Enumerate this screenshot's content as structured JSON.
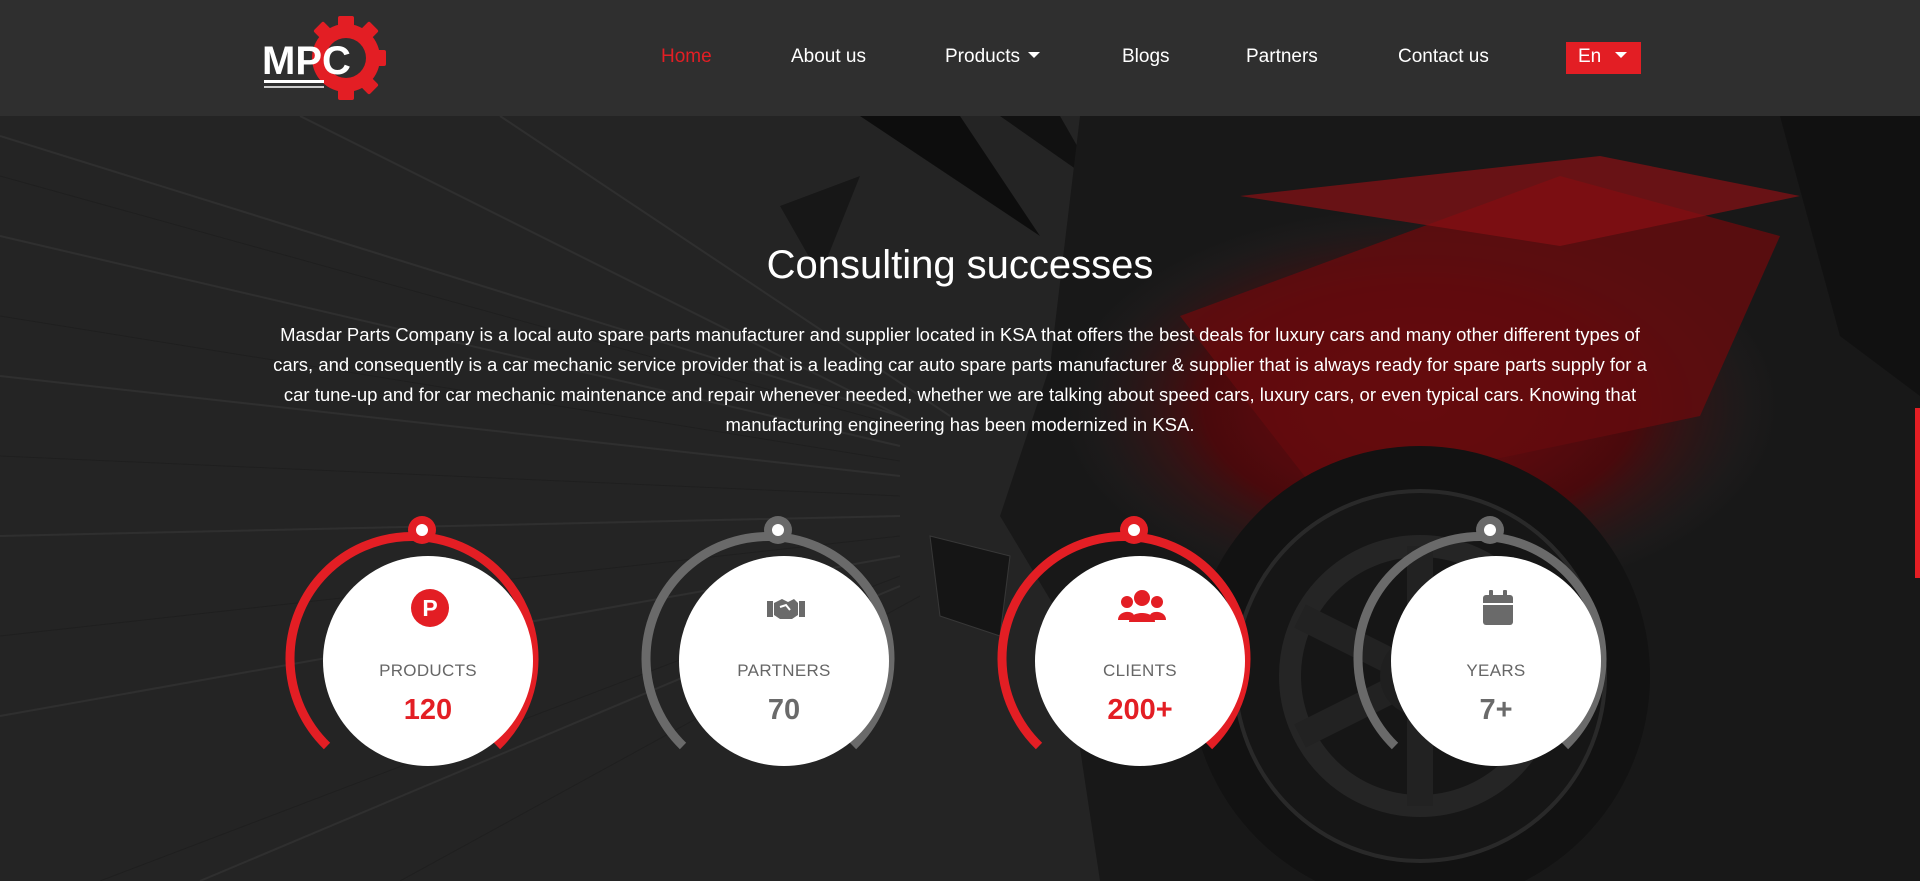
{
  "header": {
    "logo_alt": "MPC Masdar Parts Company",
    "nav": [
      {
        "label": "Home",
        "active": true
      },
      {
        "label": "About us"
      },
      {
        "label": "Products",
        "dropdown": true
      },
      {
        "label": "Blogs"
      },
      {
        "label": "Partners"
      },
      {
        "label": "Contact us"
      }
    ],
    "language": "En"
  },
  "section": {
    "title": "Consulting successes",
    "description": "Masdar Parts Company is a local auto spare parts manufacturer and supplier located in KSA that offers the best deals for luxury cars and many other different types of cars, and consequently is a car mechanic service provider that is a leading car auto spare parts manufacturer & supplier that is always ready for spare parts supply for a car tune-up and for car mechanic maintenance and repair whenever needed, whether we are talking about speed cars, luxury cars, or even typical cars. Knowing that manufacturing engineering has been modernized in KSA."
  },
  "stats": [
    {
      "label": "PRODUCTS",
      "value": "120",
      "icon": "products-p-icon",
      "accent": "#e31e24"
    },
    {
      "label": "PARTNERS",
      "value": "70",
      "icon": "handshake-icon",
      "accent": "#6a6a6a"
    },
    {
      "label": "CLIENTS",
      "value": "200+",
      "icon": "users-icon",
      "accent": "#e31e24"
    },
    {
      "label": "YEARS",
      "value": "7+",
      "icon": "calendar-icon",
      "accent": "#6a6a6a"
    }
  ],
  "colors": {
    "brand": "#e31e24",
    "header_bg": "#2f2f2f",
    "gray": "#6a6a6a"
  }
}
